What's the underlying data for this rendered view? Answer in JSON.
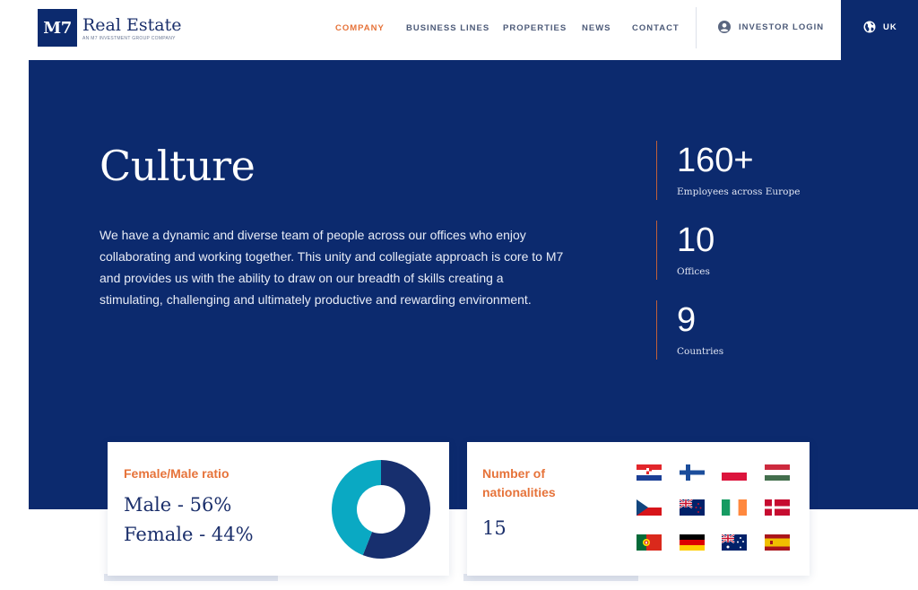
{
  "header": {
    "logo_mark": "M7",
    "logo_name": "Real Estate",
    "logo_sub": "AN M7 INVESTMENT GROUP COMPANY",
    "nav": [
      "COMPANY",
      "BUSINESS LINES",
      "PROPERTIES",
      "NEWS",
      "CONTACT"
    ],
    "active_nav": "COMPANY",
    "investor_login": "INVESTOR LOGIN",
    "language": "UK"
  },
  "hero": {
    "title": "Culture",
    "text": "We have a dynamic and diverse team of people across our offices who enjoy collaborating and working together. This unity and collegiate approach is core to M7 and provides us with the ability to draw on our breadth of skills creating a stimulating, challenging and ultimately productive and rewarding environment.",
    "stats": [
      {
        "value": "160+",
        "label": "Employees across Europe"
      },
      {
        "value": "10",
        "label": "Offices"
      },
      {
        "value": "9",
        "label": "Countries"
      }
    ]
  },
  "ratio_card": {
    "title": "Female/Male ratio",
    "male_line": "Male - 56%",
    "female_line": "Female - 44%",
    "male_percent": 56,
    "female_percent": 44
  },
  "nationality_card": {
    "title_line1": "Number of",
    "title_line2": "nationalities",
    "count": "15",
    "flags": [
      "croatia-flag",
      "finland-flag",
      "poland-flag",
      "hungary-flag",
      "czech-flag",
      "new-zealand-flag",
      "ireland-flag",
      "denmark-flag",
      "portugal-flag",
      "germany-flag",
      "australia-flag",
      "spain-flag"
    ]
  },
  "colors": {
    "navy": "#0c2a6e",
    "accent_orange": "#e6733a",
    "donut_male": "#172f6e",
    "donut_female": "#0aa9c3"
  }
}
